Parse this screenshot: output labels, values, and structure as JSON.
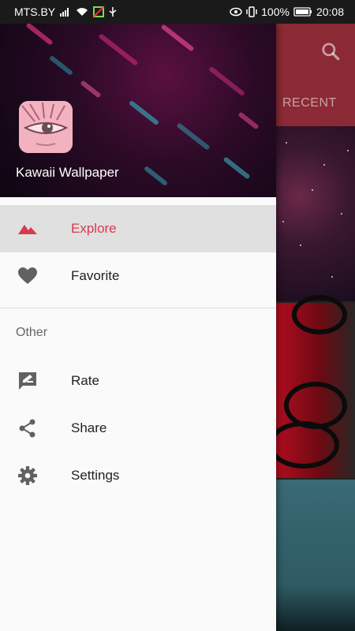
{
  "status_bar": {
    "carrier": "MTS.BY",
    "battery": "100%",
    "time": "20:08"
  },
  "background_app": {
    "tab_label": "RECENT",
    "search_icon": "search-icon",
    "accent": "#8b2a35"
  },
  "drawer": {
    "app_title": "Kawaii Wallpaper",
    "accent": "#d8394c",
    "items": [
      {
        "label": "Explore",
        "icon": "landscape-icon",
        "active": true
      },
      {
        "label": "Favorite",
        "icon": "heart-icon",
        "active": false
      }
    ],
    "section_title": "Other",
    "other_items": [
      {
        "label": "Rate",
        "icon": "rate-review-icon"
      },
      {
        "label": "Share",
        "icon": "share-icon"
      },
      {
        "label": "Settings",
        "icon": "gear-icon"
      }
    ]
  }
}
